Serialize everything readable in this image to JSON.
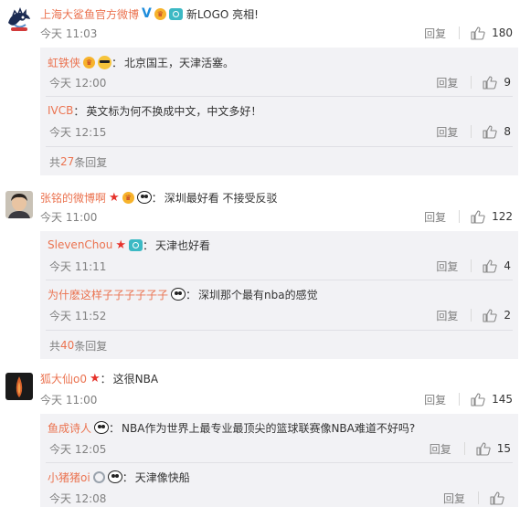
{
  "threads": [
    {
      "user": "上海大鲨鱼官方微博",
      "text": "新LOGO 亮相!",
      "time": "今天 11:03",
      "reply_label": "回复",
      "likes": "180",
      "replies": [
        {
          "user": "虹铁侠",
          "text": "北京国王，天津活塞。",
          "time": "今天 12:00",
          "reply_label": "回复",
          "likes": "9"
        },
        {
          "user": "IVCB",
          "text": "英文标为何不换成中文，中文多好！",
          "time": "今天 12:15",
          "reply_label": "回复",
          "likes": "8"
        }
      ],
      "more": {
        "prefix": "共",
        "count": "27",
        "suffix": "条回复"
      }
    },
    {
      "user": "张铭的微博啊",
      "text": "深圳最好看 不接受反驳",
      "time": "今天 11:00",
      "reply_label": "回复",
      "likes": "122",
      "replies": [
        {
          "user": "SlevenChou",
          "text": "天津也好看",
          "time": "今天 11:11",
          "reply_label": "回复",
          "likes": "4"
        },
        {
          "user": "为什麽这样子子子子子子",
          "text": "深圳那个最有nba的感觉",
          "time": "今天 11:52",
          "reply_label": "回复",
          "likes": "2"
        }
      ],
      "more": {
        "prefix": "共",
        "count": "40",
        "suffix": "条回复"
      }
    },
    {
      "user": "狐大仙o0",
      "text": "这很NBA",
      "time": "今天 11:00",
      "reply_label": "回复",
      "likes": "145",
      "replies": [
        {
          "user": "鱼成诗人",
          "text": "NBA作为世界上最专业最顶尖的篮球联赛像NBA难道不好吗?",
          "time": "今天 12:05",
          "reply_label": "回复",
          "likes": "15"
        },
        {
          "user": "小猪猪oi",
          "text": "天津像快船",
          "time": "今天 12:08",
          "reply_label": "回复",
          "likes": ""
        }
      ]
    }
  ],
  "colors": {
    "username": "#eb7350",
    "meta": "#808080",
    "reply_bg": "#f2f2f5",
    "verified": "#1f8ddc"
  },
  "icons": {
    "like": "thumbs-up-icon",
    "verified": "verified-v-icon",
    "vip": "crown-icon",
    "camera": "camera-icon",
    "star": "red-star-icon",
    "panda": "panda-emoji-icon"
  }
}
